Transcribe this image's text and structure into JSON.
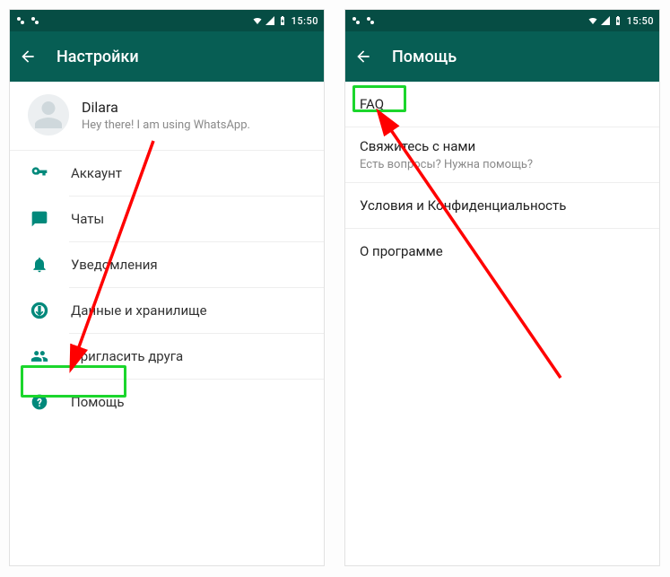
{
  "status": {
    "time": "15:50"
  },
  "left": {
    "title": "Настройки",
    "profile": {
      "name": "Dilara",
      "status": "Hey there! I am using WhatsApp."
    },
    "items": [
      {
        "label": "Аккаунт"
      },
      {
        "label": "Чаты"
      },
      {
        "label": "Уведомления"
      },
      {
        "label": "Данные и хранилище"
      },
      {
        "label": "Пригласить друга"
      },
      {
        "label": "Помощь"
      }
    ]
  },
  "right": {
    "title": "Помощь",
    "items": [
      {
        "label": "FAQ"
      },
      {
        "label": "Свяжитесь с нами",
        "sub": "Есть вопросы? Нужна помощь?"
      },
      {
        "label": "Условия и Конфиденциальность"
      },
      {
        "label": "О программе"
      }
    ]
  }
}
